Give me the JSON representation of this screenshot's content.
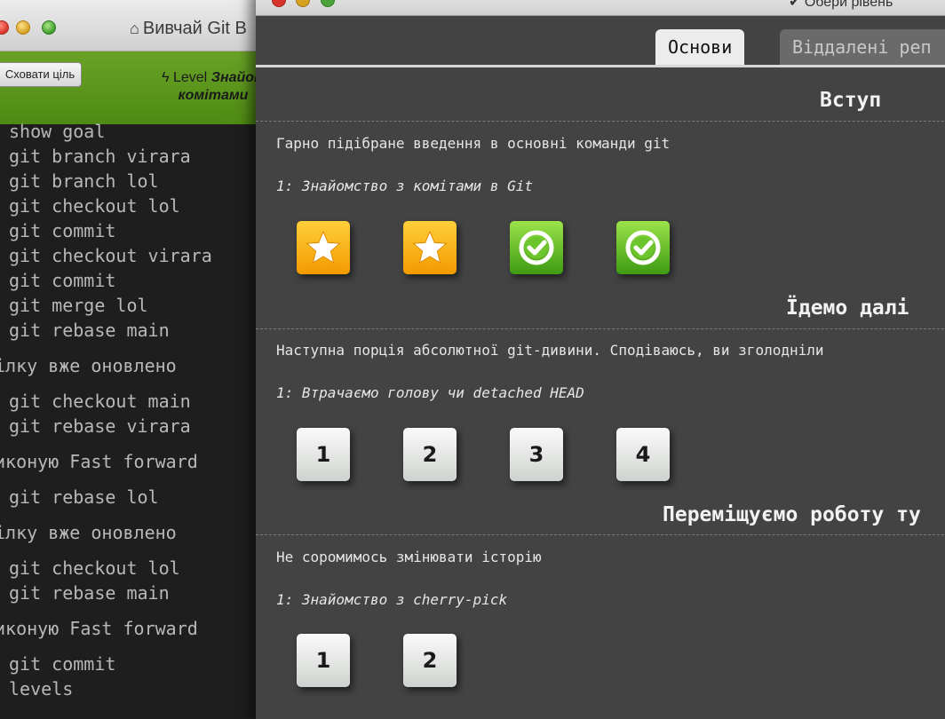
{
  "background_window": {
    "title": "Вивчай Git B",
    "hide_goal_button": "Сховати ціль",
    "level_prefix": "Level",
    "level_name_line1": "Знайом",
    "level_name_line2": "комітами",
    "terminal_lines": [
      "show goal",
      "git branch virara",
      "git branch lol",
      "git checkout lol",
      "git commit",
      "git checkout virara",
      "git commit",
      "git merge lol",
      "git rebase main",
      "ілку вже оновлено",
      "git checkout main",
      "git rebase virara",
      "иконую Fast forward",
      "git rebase lol",
      "ілку вже оновлено",
      "git checkout lol",
      "git rebase main",
      "иконую Fast forward",
      "git commit",
      "levels"
    ]
  },
  "modal": {
    "choose_level": "✔ Обери рівень",
    "tabs": [
      {
        "label": "Основи",
        "active": true
      },
      {
        "label": "Віддалені реп",
        "active": false
      }
    ],
    "sections": [
      {
        "title": "Вступ",
        "description": "Гарно підібране введення в основні команди git",
        "subtitle": "1: Знайомство з комітами в Git",
        "levels": [
          {
            "kind": "star",
            "label": "star-icon"
          },
          {
            "kind": "star",
            "label": "star-icon"
          },
          {
            "kind": "check",
            "label": "check-icon"
          },
          {
            "kind": "check",
            "label": "check-icon"
          }
        ]
      },
      {
        "title": "Їдемо далі",
        "description": "Наступна порція абсолютної git-дивини. Сподіваюсь, ви зголодніли",
        "subtitle": "1: Втрачаємо голову чи detached HEAD",
        "levels": [
          {
            "kind": "number",
            "label": "1"
          },
          {
            "kind": "number",
            "label": "2"
          },
          {
            "kind": "number",
            "label": "3"
          },
          {
            "kind": "number",
            "label": "4"
          }
        ]
      },
      {
        "title": "Переміщуємо роботу ту",
        "description": "Не соромимось змінювати історію",
        "subtitle": "1: Знайомство з cherry-pick",
        "levels": [
          {
            "kind": "number",
            "label": "1"
          },
          {
            "kind": "number",
            "label": "2"
          }
        ]
      }
    ]
  },
  "colors": {
    "modal_bg": "#434343",
    "gold_start": "#ffcf3a",
    "gold_end": "#f39a00",
    "green_start": "#9be34a",
    "green_end": "#3f9a12",
    "greenbar": "#5a9620"
  }
}
